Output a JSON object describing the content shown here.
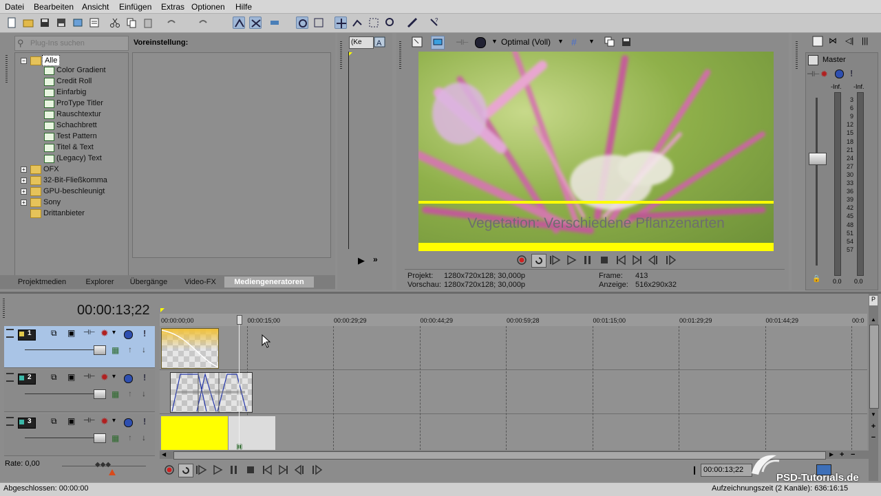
{
  "menu": [
    "Datei",
    "Bearbeiten",
    "Ansicht",
    "Einfügen",
    "Extras",
    "Optionen",
    "Hilfe"
  ],
  "plugin_search": {
    "placeholder": "Plug-Ins suchen"
  },
  "preset_label": "Voreinstellung:",
  "tree": {
    "root": "Alle",
    "generators": [
      "Color Gradient",
      "Credit Roll",
      "Einfarbig",
      "ProType Titler",
      "Rauschtextur",
      "Schachbrett",
      "Test Pattern",
      "Titel & Text",
      "(Legacy) Text"
    ],
    "folders": [
      "OFX",
      "32-Bit-Fließkomma",
      "GPU-beschleunigt",
      "Sony",
      "Drittanbieter"
    ]
  },
  "tabs": [
    "Projektmedien",
    "Explorer",
    "Übergänge",
    "Video-FX",
    "Mediengeneratoren"
  ],
  "trimmer": {
    "dropdown": "(Ke"
  },
  "preview": {
    "quality": "Optimal (Voll)",
    "overlay_text": "Vegetation: Verschiedene Pflanzenarten",
    "projekt_label": "Projekt:",
    "projekt_value": "1280x720x128; 30,000p",
    "vorschau_label": "Vorschau:",
    "vorschau_value": "1280x720x128; 30,000p",
    "frame_label": "Frame:",
    "frame_value": "413",
    "anzeige_label": "Anzeige:",
    "anzeige_value": "516x290x32"
  },
  "mixer": {
    "title": "Master",
    "inf_left": "-Inf.",
    "inf_right": "-Inf.",
    "scale": [
      "3",
      "6",
      "9",
      "12",
      "15",
      "18",
      "21",
      "24",
      "27",
      "30",
      "33",
      "36",
      "39",
      "42",
      "45",
      "48",
      "51",
      "54",
      "57"
    ],
    "value_left": "0.0",
    "value_right": "0.0"
  },
  "timeline": {
    "timecode": "00:00:13;22",
    "ruler": [
      "00:00:00;00",
      "00:00:15;00",
      "00:00:29;29",
      "00:00:44;29",
      "00:00:59;28",
      "00:01:15;00",
      "00:01:29;29",
      "00:01:44;29",
      "00:0"
    ],
    "tracks": [
      "1",
      "2",
      "3"
    ],
    "rate": "Rate: 0,00",
    "cursor_time": "00:00:13;22"
  },
  "status": {
    "left": "Abgeschlossen: 00:00:00",
    "right": "Aufzeichnungszeit (2 Kanäle): 636:16:15"
  },
  "watermark": "PSD-Tutorials.de",
  "colors": {
    "accent": "#ffff00",
    "selection": "#a9c4e6",
    "panel": "#8b8b8b"
  }
}
